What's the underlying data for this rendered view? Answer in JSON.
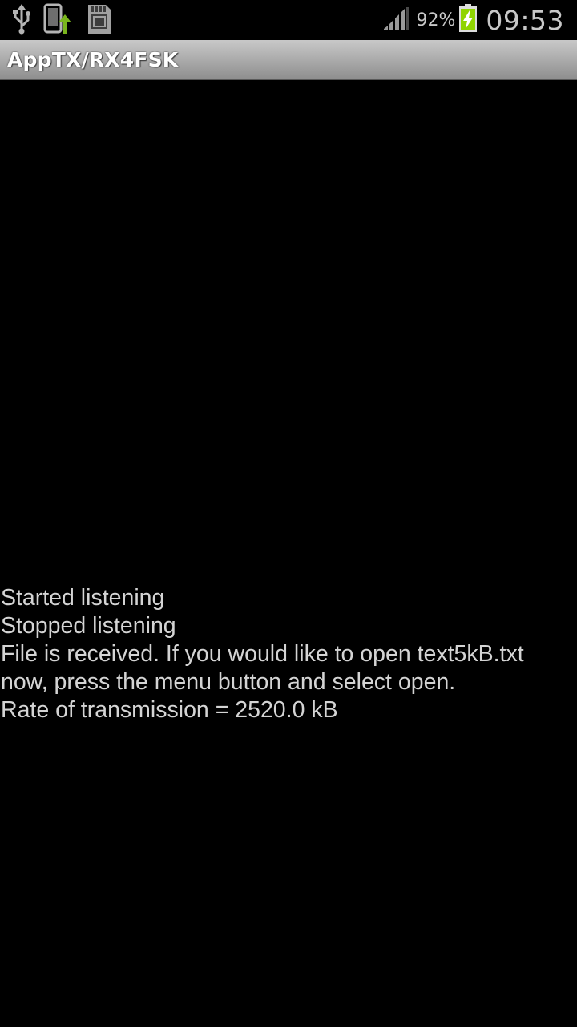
{
  "status_bar": {
    "icons_left": [
      "usb-icon",
      "phone-upload-icon",
      "sd-card-icon"
    ],
    "signal_icon": "signal-strength-icon",
    "battery_percent": "92%",
    "battery_icon": "battery-charging-icon",
    "time": "09:53",
    "colors": {
      "text": "#c8c8c8",
      "battery_fill": "#8fd400",
      "upload_arrow": "#7ab51d"
    }
  },
  "title_bar": {
    "title": "AppTX/RX4FSK"
  },
  "log": {
    "lines": [
      "Started listening",
      "Stopped listening",
      "File is received. If you would like to open text5kB.txt now, press the menu button and select open.",
      "Rate of transmission = 2520.0 kB"
    ]
  }
}
